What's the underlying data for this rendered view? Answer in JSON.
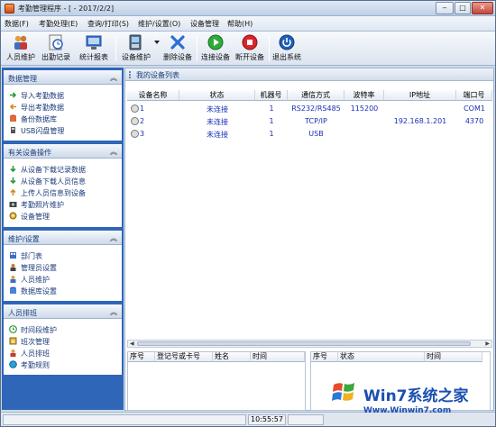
{
  "window": {
    "title": "考勤管理程序 - [ - 2017/2/2]"
  },
  "menu": [
    "数据(F)",
    "考勤处理(E)",
    "查询/打印(S)",
    "维护/设置(O)",
    "设备管理",
    "帮助(H)"
  ],
  "toolbar": [
    {
      "label": "人员维护",
      "icon": "users-icon"
    },
    {
      "label": "出勤记录",
      "icon": "clock-icon"
    },
    {
      "label": "统计报表",
      "icon": "report-icon"
    },
    {
      "label": "设备维护",
      "icon": "device-icon"
    },
    {
      "label": "删除设备",
      "icon": "delete-icon"
    },
    {
      "label": "连接设备",
      "icon": "play-icon"
    },
    {
      "label": "断开设备",
      "icon": "stop-icon"
    },
    {
      "label": "退出系统",
      "icon": "power-icon"
    }
  ],
  "sidebar": {
    "panels": [
      {
        "title": "数据管理",
        "items": [
          "导入考勤数据",
          "导出考勤数据",
          "备份数据库",
          "USB闪盘管理"
        ]
      },
      {
        "title": "有关设备操作",
        "items": [
          "从设备下载记录数据",
          "从设备下载人员信息",
          "上传人员信息到设备",
          "考勤照片维护",
          "设备管理"
        ]
      },
      {
        "title": "维护/设置",
        "items": [
          "部门表",
          "管理员设置",
          "人员维护",
          "数据库设置"
        ]
      },
      {
        "title": "人员排班",
        "items": [
          "时间段维护",
          "班次管理",
          "人员排班",
          "考勤规则"
        ]
      }
    ]
  },
  "main": {
    "title": "我的设备列表",
    "columns": [
      "设备名称",
      "状态",
      "机器号",
      "通信方式",
      "波特率",
      "IP地址",
      "端口号"
    ],
    "rows": [
      [
        "1",
        "未连接",
        "1",
        "RS232/RS485",
        "115200",
        "",
        "COM1"
      ],
      [
        "2",
        "未连接",
        "1",
        "TCP/IP",
        "",
        "192.168.1.201",
        "4370"
      ],
      [
        "3",
        "未连接",
        "1",
        "USB",
        "",
        "",
        ""
      ]
    ]
  },
  "bottom_left": {
    "columns": [
      "序号",
      "登记号或卡号",
      "姓名",
      "时间"
    ]
  },
  "bottom_right": {
    "columns": [
      "序号",
      "状态",
      "时间"
    ]
  },
  "status": {
    "time": "10:55:57"
  },
  "watermark": {
    "brand": "Win7系统之家",
    "url": "Www.Winwin7.com"
  }
}
